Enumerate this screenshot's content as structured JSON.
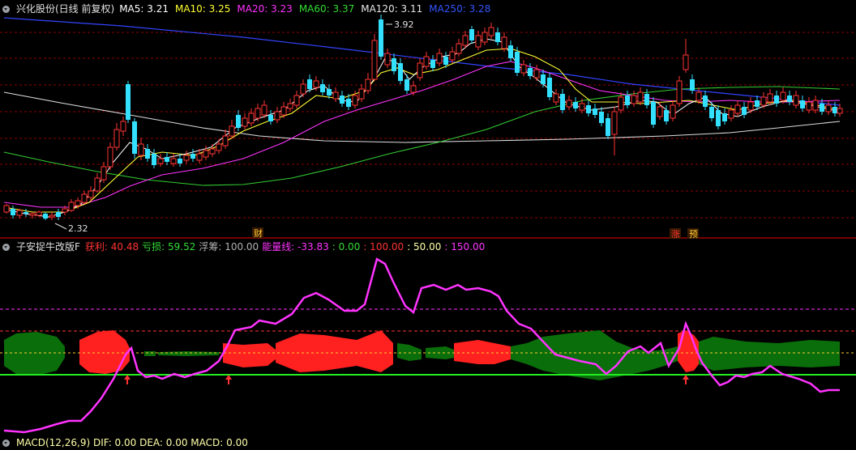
{
  "main_header": {
    "title": "兴化股份(日线 前复权)",
    "ma": [
      {
        "label": "MA5: 3.21",
        "color": "#ffffff"
      },
      {
        "label": "MA10: 3.25",
        "color": "#ffff33"
      },
      {
        "label": "MA20: 3.23",
        "color": "#ff33ff"
      },
      {
        "label": "MA60: 3.37",
        "color": "#33dd33"
      },
      {
        "label": "MA120: 3.11",
        "color": "#e6e6e6"
      },
      {
        "label": "MA250: 3.28",
        "color": "#3355ff"
      }
    ]
  },
  "price_annotations": {
    "high": "3.92",
    "low": "2.32"
  },
  "event_tags": {
    "cai": "财",
    "zhang": "涨",
    "yu": "预"
  },
  "indicator_header": {
    "title": "子安捉牛改版F",
    "items": [
      {
        "label": "获利: 40.48",
        "color": "#ff3333"
      },
      {
        "label": "亏损: 59.52",
        "color": "#33dd33"
      },
      {
        "label": "浮筹: 100.00",
        "color": "#b0b0b0"
      },
      {
        "label": "能量线: -33.83",
        "color": "#ff33ff"
      },
      {
        "label": ": 0.00",
        "color": "#33dd33"
      },
      {
        "label": ": 100.00",
        "color": "#ff3333"
      },
      {
        "label": ": 50.00",
        "color": "#ffffaa"
      },
      {
        "label": ": 150.00",
        "color": "#ff33ff"
      }
    ]
  },
  "bottom_header": {
    "text": "MACD(12,26,9) DIF: 0.00 DEA: 0.00 MACD: 0.00"
  },
  "colors": {
    "up": "#ff3333",
    "down": "#33e0ff",
    "profit": "#ff2020",
    "loss": "#0a6e0a",
    "energy": "#ff33ff",
    "zero_line": "#22ee22"
  }
}
